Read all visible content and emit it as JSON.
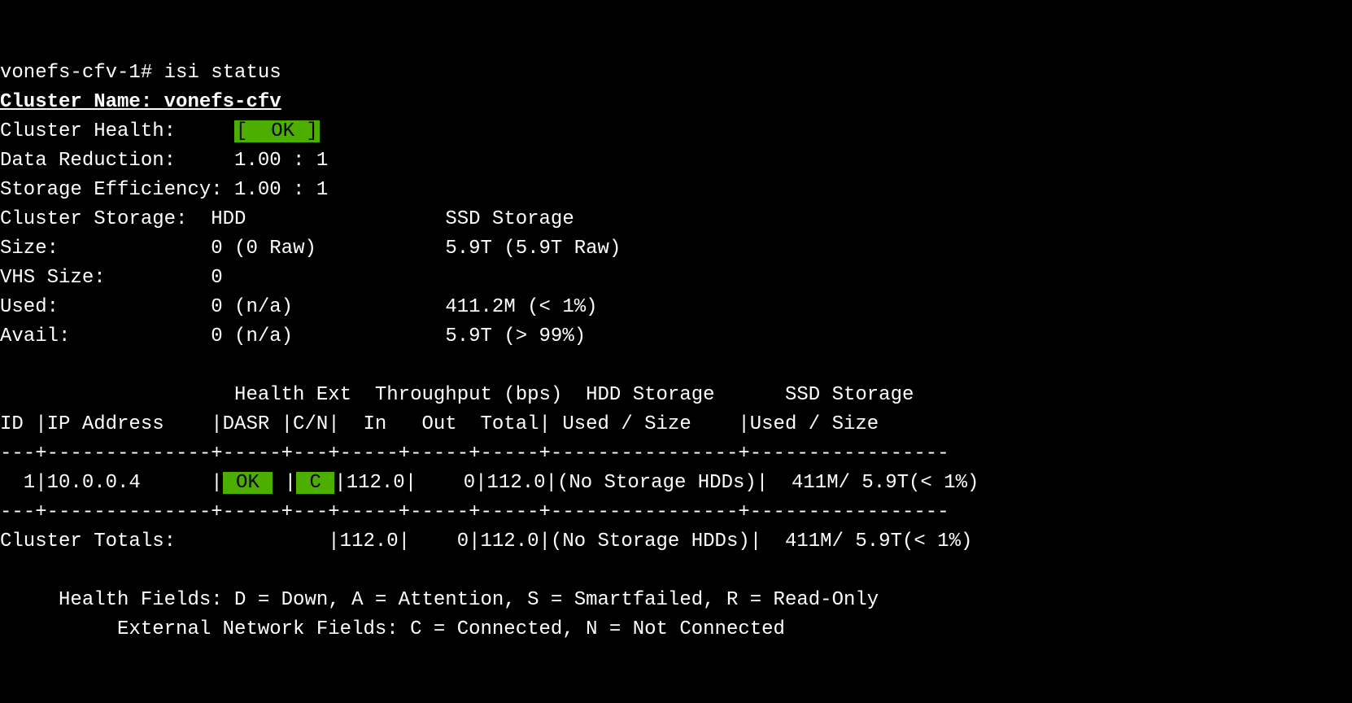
{
  "prompt": {
    "hostname": "vonefs-cfv-1",
    "command": "isi status"
  },
  "cluster": {
    "name_label": "Cluster Name: ",
    "name_value": "vonefs-cfv",
    "health_label": "Cluster Health:     ",
    "health_value": "[  OK ]",
    "data_reduction_label": "Data Reduction:     ",
    "data_reduction_value": "1.00 : 1",
    "storage_efficiency_label": "Storage Efficiency: ",
    "storage_efficiency_value": "1.00 : 1",
    "storage_label": "Cluster Storage:  ",
    "hdd_label": "HDD",
    "ssd_label": "SSD Storage",
    "size_label": "Size:             ",
    "size_hdd": "0 (0 Raw)",
    "size_ssd": "5.9T (5.9T Raw)",
    "vhs_label": "VHS Size:         ",
    "vhs_value": "0",
    "used_label": "Used:             ",
    "used_hdd": "0 (n/a)",
    "used_ssd": "411.2M (< 1%)",
    "avail_label": "Avail:            ",
    "avail_hdd": "0 (n/a)",
    "avail_ssd": "5.9T (> 99%)"
  },
  "table": {
    "header1": "                    Health Ext  Throughput (bps)  HDD Storage      SSD Storage",
    "header2": "ID |IP Address    |DASR |C/N|  In   Out  Total| Used / Size    |Used / Size",
    "divider": "---+--------------+-----+---+-----+-----+-----+----------------+-----------------",
    "row_prefix": "  1|10.0.0.4      |",
    "row_health": " OK ",
    "row_mid1": " |",
    "row_ext": " C ",
    "row_suffix": "|112.0|    0|112.0|(No Storage HDDs)|  411M/ 5.9T(< 1%)",
    "totals": "Cluster Totals:             |112.0|    0|112.0|(No Storage HDDs)|  411M/ 5.9T(< 1%)"
  },
  "legend": {
    "health": "     Health Fields: D = Down, A = Attention, S = Smartfailed, R = Read-Only",
    "network": "          External Network Fields: C = Connected, N = Not Connected"
  }
}
